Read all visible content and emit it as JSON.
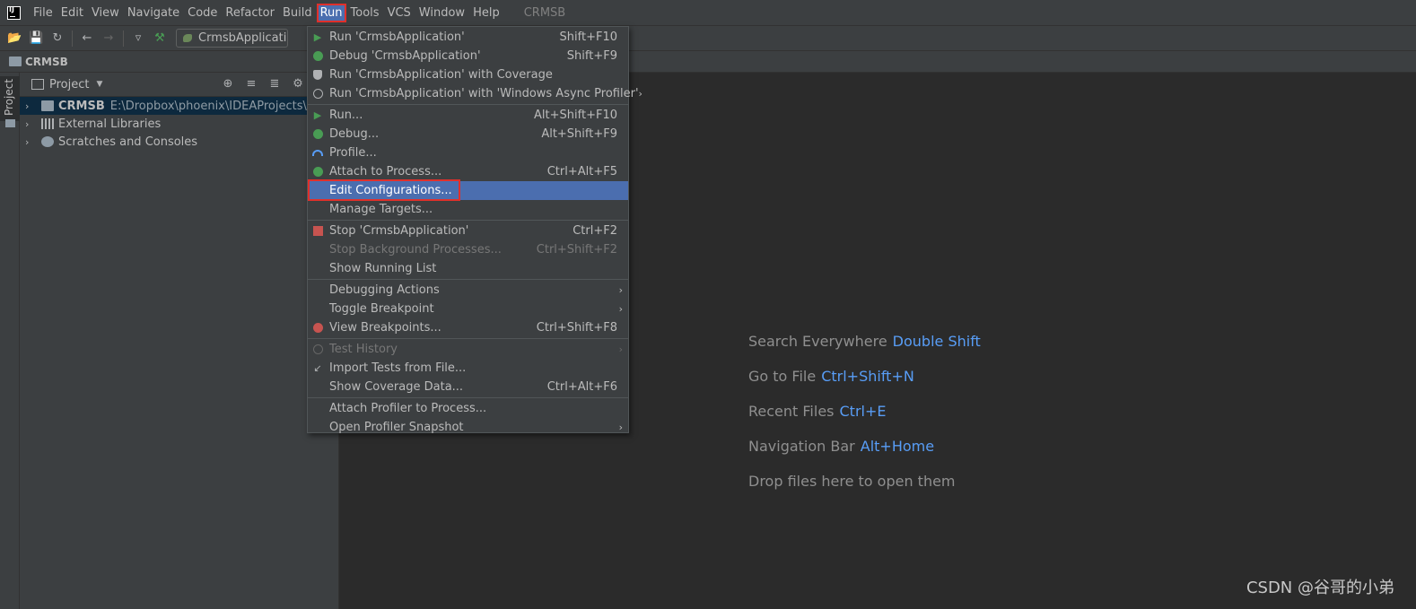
{
  "menubar": {
    "items": [
      "File",
      "Edit",
      "View",
      "Navigate",
      "Code",
      "Refactor",
      "Build",
      "Run",
      "Tools",
      "VCS",
      "Window",
      "Help"
    ],
    "active_index": 7,
    "project_title": "CRMSB"
  },
  "toolbar": {
    "run_config": "CrmsbApplication"
  },
  "navbar": {
    "project": "CRMSB"
  },
  "sidestrip": {
    "project_tab": "Project"
  },
  "project_panel": {
    "header": "Project",
    "tree": [
      {
        "name": "CRMSB",
        "path": "E:\\Dropbox\\phoenix\\IDEAProjects\\CRM",
        "bold": true,
        "selected": true,
        "icon": "module-folder-icon"
      },
      {
        "name": "External Libraries",
        "path": "",
        "bold": false,
        "selected": false,
        "icon": "library-icon"
      },
      {
        "name": "Scratches and Consoles",
        "path": "",
        "bold": false,
        "selected": false,
        "icon": "scratches-icon"
      }
    ]
  },
  "run_menu": {
    "items": [
      {
        "label": "Run 'CrmsbApplication'",
        "shortcut": "Shift+F10",
        "icon": "run-icon"
      },
      {
        "label": "Debug 'CrmsbApplication'",
        "shortcut": "Shift+F9",
        "icon": "debug-icon"
      },
      {
        "label": "Run 'CrmsbApplication' with Coverage",
        "shortcut": "",
        "icon": "coverage-icon"
      },
      {
        "label": "Run 'CrmsbApplication' with 'Windows Async Profiler'",
        "shortcut": "",
        "icon": "profiler-icon",
        "submenu": true
      },
      {
        "sep": true
      },
      {
        "label": "Run...",
        "shortcut": "Alt+Shift+F10",
        "icon": "run-icon"
      },
      {
        "label": "Debug...",
        "shortcut": "Alt+Shift+F9",
        "icon": "debug-icon"
      },
      {
        "label": "Profile...",
        "shortcut": "",
        "icon": "profile-icon"
      },
      {
        "label": "Attach to Process...",
        "shortcut": "Ctrl+Alt+F5",
        "icon": "attach-icon"
      },
      {
        "label": "Edit Configurations...",
        "shortcut": "",
        "icon": "",
        "highlight": true
      },
      {
        "label": "Manage Targets...",
        "shortcut": "",
        "icon": ""
      },
      {
        "sep": true
      },
      {
        "label": "Stop 'CrmsbApplication'",
        "shortcut": "Ctrl+F2",
        "icon": "stop-icon"
      },
      {
        "label": "Stop Background Processes...",
        "shortcut": "Ctrl+Shift+F2",
        "icon": "",
        "disabled": true
      },
      {
        "label": "Show Running List",
        "shortcut": "",
        "icon": ""
      },
      {
        "sep": true
      },
      {
        "label": "Debugging Actions",
        "shortcut": "",
        "icon": "",
        "submenu": true
      },
      {
        "label": "Toggle Breakpoint",
        "shortcut": "",
        "icon": "",
        "submenu": true
      },
      {
        "label": "View Breakpoints...",
        "shortcut": "Ctrl+Shift+F8",
        "icon": "breakpoints-icon"
      },
      {
        "sep": true
      },
      {
        "label": "Test History",
        "shortcut": "",
        "icon": "history-icon",
        "disabled": true,
        "submenu": true
      },
      {
        "label": "Import Tests from File...",
        "shortcut": "",
        "icon": "import-icon"
      },
      {
        "label": "Show Coverage Data...",
        "shortcut": "Ctrl+Alt+F6",
        "icon": ""
      },
      {
        "sep": true
      },
      {
        "label": "Attach Profiler to Process...",
        "shortcut": "",
        "icon": ""
      },
      {
        "label": "Open Profiler Snapshot",
        "shortcut": "",
        "icon": "",
        "submenu": true
      }
    ]
  },
  "editor": {
    "hints": [
      {
        "text": "Search Everywhere",
        "key": "Double Shift"
      },
      {
        "text": "Go to File",
        "key": "Ctrl+Shift+N"
      },
      {
        "text": "Recent Files",
        "key": "Ctrl+E"
      },
      {
        "text": "Navigation Bar",
        "key": "Alt+Home"
      },
      {
        "text": "Drop files here to open them",
        "key": ""
      }
    ],
    "watermark": "CSDN @谷哥的小弟"
  },
  "colors": {
    "highlight": "#4b6eaf",
    "annotation_box": "#e0302b",
    "hint_key": "#589df6"
  }
}
